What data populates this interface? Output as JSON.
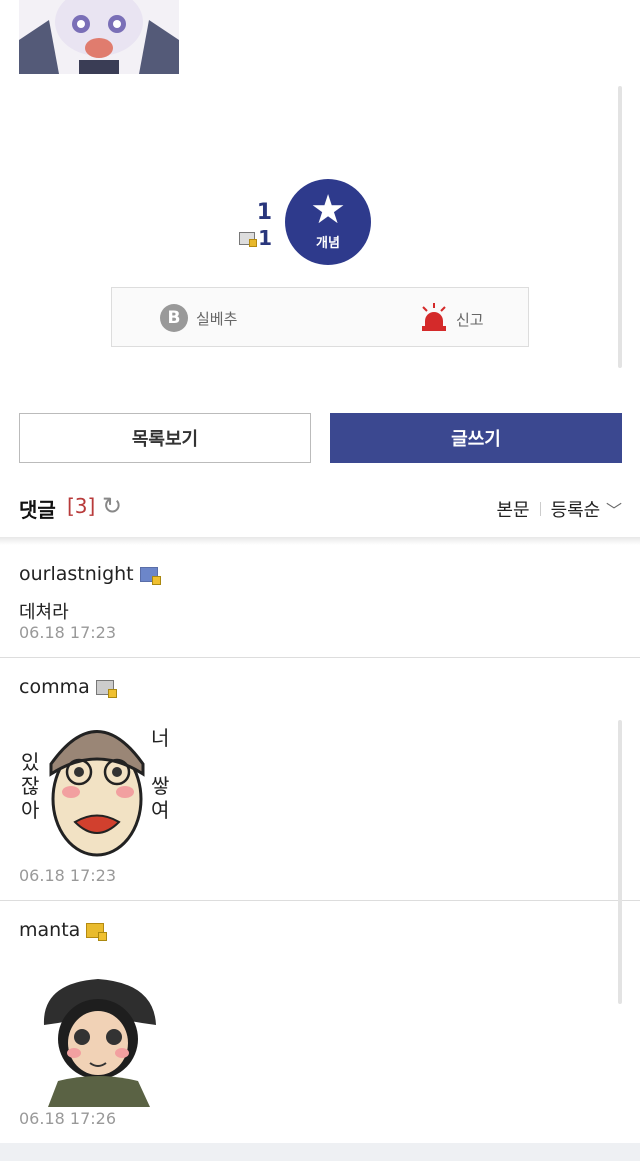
{
  "recommend": {
    "up_count": "1",
    "fixed_count": "1",
    "concept_label": "개념"
  },
  "actions": {
    "b_letter": "B",
    "silbechu_label": "실베추",
    "report_label": "신고"
  },
  "buttons": {
    "list_label": "목록보기",
    "write_label": "글쓰기"
  },
  "comments_header": {
    "title": "댓글",
    "count": "[3]",
    "sort_body": "본문",
    "sort_order": "등록순"
  },
  "comments": [
    {
      "author": "ourlastnight",
      "text": "데쳐라",
      "time": "06.18 17:23",
      "icon": "gallog-blue-icon"
    },
    {
      "author": "comma",
      "text": "",
      "time": "06.18 17:23",
      "icon": "gallog-gray-icon",
      "sticker_text": [
        "있",
        "잖",
        "아",
        "너",
        "쌓",
        "여"
      ]
    },
    {
      "author": "manta",
      "text": "",
      "time": "06.18 17:26",
      "icon": "gallog-gold-icon"
    }
  ],
  "colors": {
    "primary": "#3b4890",
    "concept_circle": "#2e3a8c",
    "count_red": "#b83a3a",
    "report_red": "#d42a2a"
  }
}
